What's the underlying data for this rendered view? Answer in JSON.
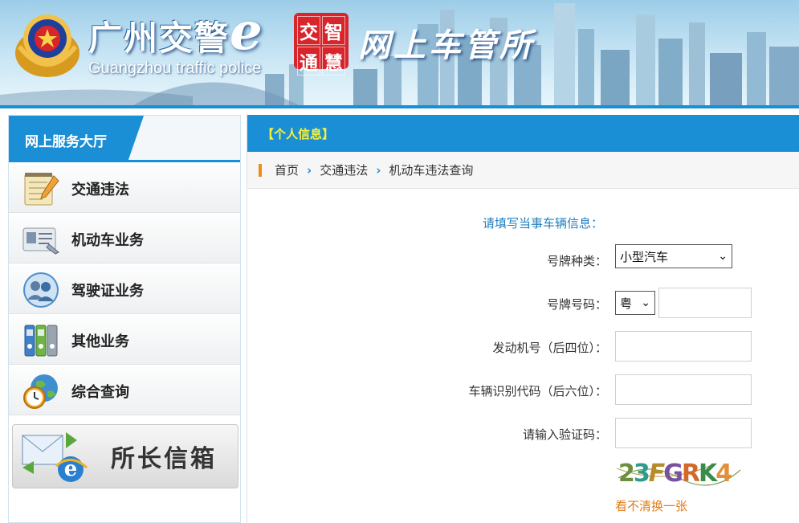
{
  "header": {
    "title_cn": "广州交警",
    "title_e": "e",
    "title_en": "Guangzhou traffic police",
    "seal_chars": [
      "交",
      "智",
      "通",
      "慧"
    ],
    "slogan": "网上车管所",
    "colors": {
      "brand_blue": "#1a8fd6",
      "seal_red": "#d8252b"
    }
  },
  "sidebar": {
    "heading": "网上服务大厅",
    "items": [
      {
        "label": "交通违法",
        "icon": "notepad-pencil-icon"
      },
      {
        "label": "机动车业务",
        "icon": "vehicle-license-card-icon"
      },
      {
        "label": "驾驶证业务",
        "icon": "user-group-icon"
      },
      {
        "label": "其他业务",
        "icon": "binders-icon"
      },
      {
        "label": "综合查询",
        "icon": "globe-clock-icon"
      }
    ],
    "mailbox": {
      "label": "所长信箱",
      "icon": "envelope-ie-icon"
    }
  },
  "main": {
    "section_title": "【个人信息】",
    "breadcrumb": [
      "首页",
      "交通违法",
      "机动车违法查询"
    ],
    "form": {
      "title": "请填写当事车辆信息：",
      "plate_type": {
        "label": "号牌种类：",
        "value": "小型汽车"
      },
      "plate_number": {
        "label": "号牌号码：",
        "prefix": "粤",
        "value": ""
      },
      "engine_no": {
        "label": "发动机号（后四位）：",
        "value": ""
      },
      "vin": {
        "label": "车辆识别代码（后六位）：",
        "value": ""
      },
      "captcha_input": {
        "label": "请输入验证码：",
        "value": ""
      },
      "captcha_text": "23FGRK4",
      "refresh_link": "看不清换一张"
    }
  }
}
